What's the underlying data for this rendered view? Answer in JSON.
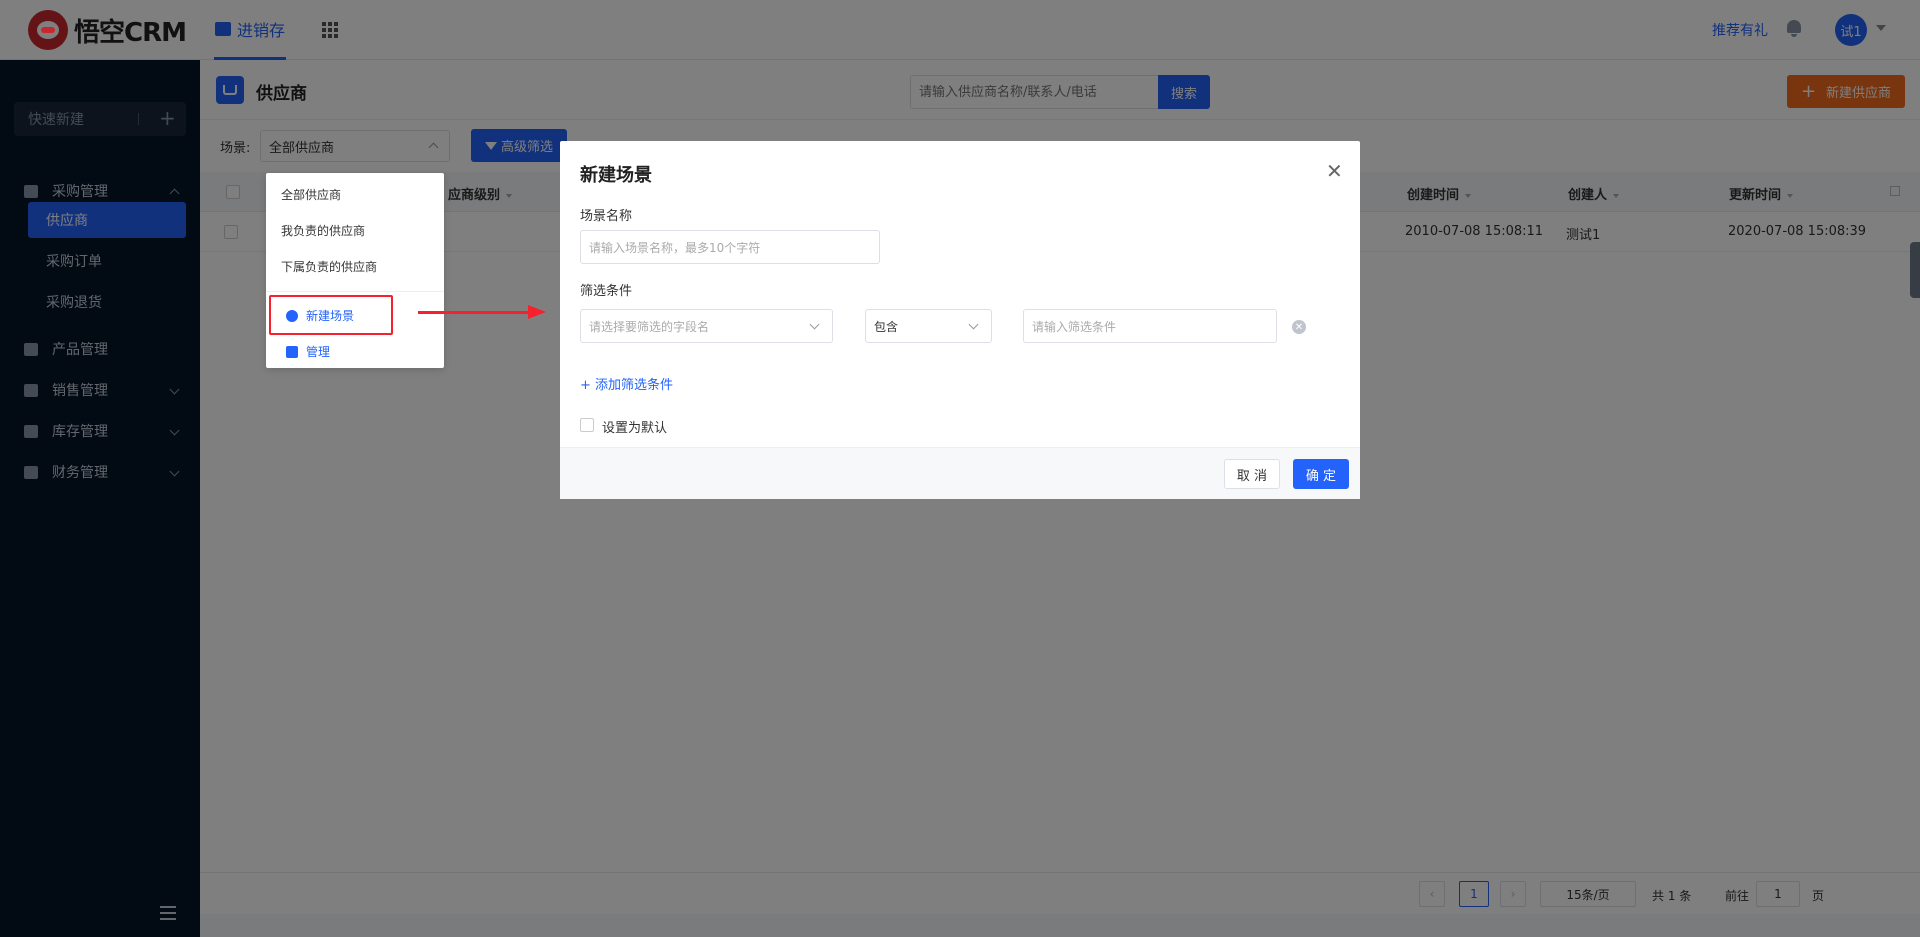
{
  "app": {
    "logo_text": "悟空CRM"
  },
  "topnav": {
    "active_tab": "进销存",
    "recommend": "推荐有礼",
    "avatar": "试1"
  },
  "sidebar": {
    "quick_new": "快速新建",
    "menus": [
      {
        "label": "采购管理",
        "expanded": true,
        "children": [
          "供应商",
          "采购订单",
          "采购退货"
        ]
      },
      {
        "label": "产品管理"
      },
      {
        "label": "销售管理"
      },
      {
        "label": "库存管理"
      },
      {
        "label": "财务管理"
      }
    ]
  },
  "page": {
    "title": "供应商",
    "search_placeholder": "请输入供应商名称/联系人/电话",
    "search_btn": "搜索",
    "new_btn": "新建供应商",
    "scene_label": "场景:",
    "scene_value": "全部供应商",
    "adv_filter": "高级筛选"
  },
  "table": {
    "columns": {
      "level": "应商级别",
      "created": "创建时间",
      "creator": "创建人",
      "updated": "更新时间"
    },
    "rows": [
      {
        "created": "2010-07-08 15:08:11",
        "creator": "测试1",
        "updated": "2020-07-08 15:08:39"
      }
    ]
  },
  "pager": {
    "page": "1",
    "size": "15条/页",
    "total": "共 1 条",
    "goto_label": "前往",
    "goto_value": "1",
    "page_unit": "页"
  },
  "dropdown": {
    "items": [
      "全部供应商",
      "我负责的供应商",
      "下属负责的供应商"
    ],
    "new_scene": "新建场景",
    "manage": "管理"
  },
  "modal": {
    "title": "新建场景",
    "name_label": "场景名称",
    "name_placeholder": "请输入场景名称，最多10个字符",
    "cond_label": "筛选条件",
    "field_placeholder": "请选择要筛选的字段名",
    "operator": "包含",
    "value_placeholder": "请输入筛选条件",
    "add_cond": "+ 添加筛选条件",
    "default_label": "设置为默认",
    "cancel": "取 消",
    "ok": "确 定"
  },
  "colors": {
    "primary": "#2362fb",
    "orange": "#f26a1b",
    "sidebar": "#051428",
    "highlight": "#f5222d"
  }
}
